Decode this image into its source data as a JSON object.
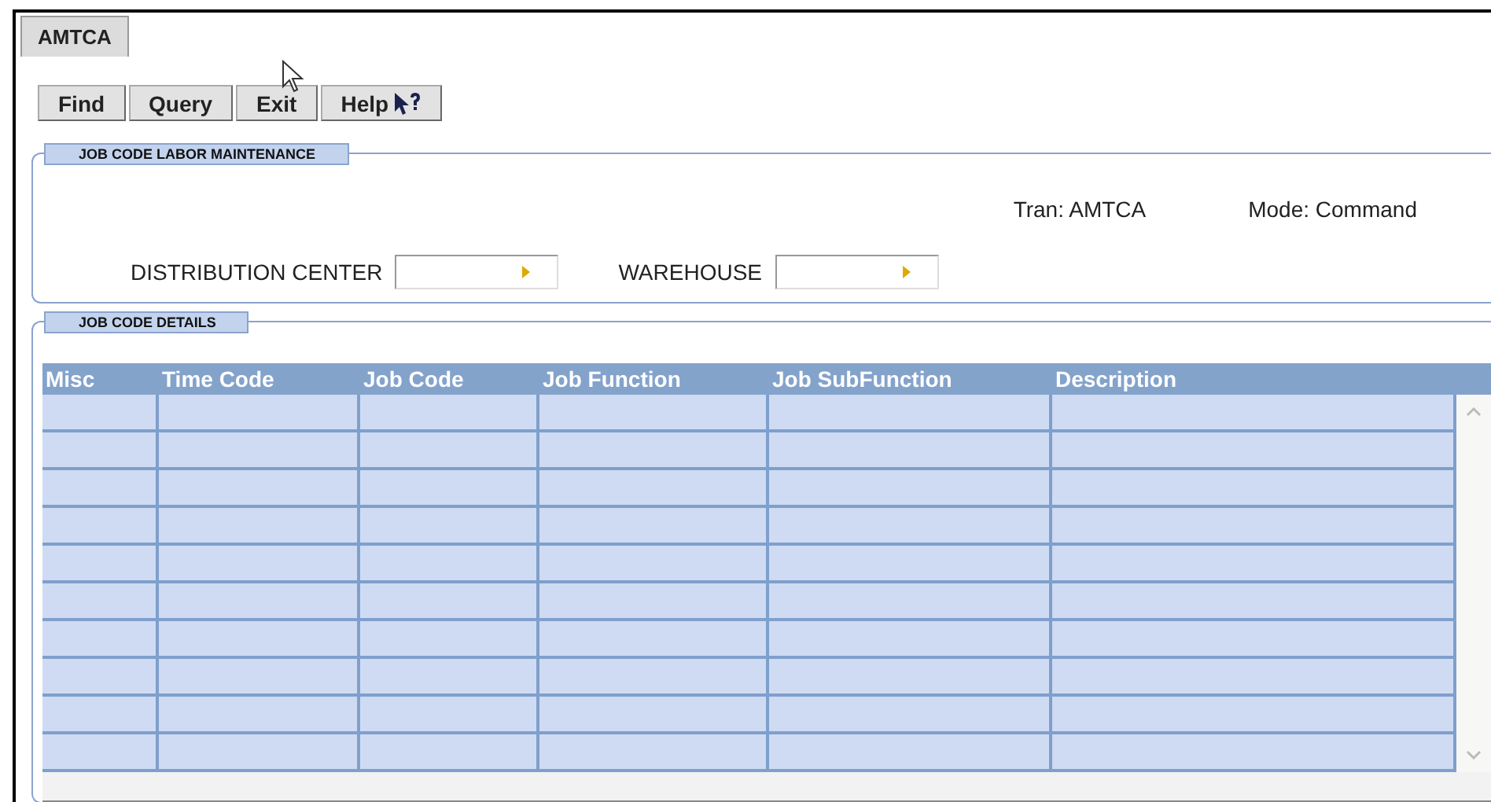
{
  "tabs": [
    {
      "label": "AMTCA",
      "selected": true
    }
  ],
  "toolbar": {
    "buttons": [
      {
        "label": "Find",
        "kind": "plain"
      },
      {
        "label": "Query",
        "kind": "plain"
      },
      {
        "label": "Exit",
        "kind": "plain"
      },
      {
        "label": "Help",
        "kind": "help"
      }
    ]
  },
  "maintenance_section": {
    "title": "JOB CODE LABOR MAINTENANCE",
    "tran": "Tran: AMTCA",
    "mode": "Mode: Command",
    "fields": [
      {
        "label": "DISTRIBUTION CENTER"
      },
      {
        "label": "WAREHOUSE"
      }
    ]
  },
  "details_section": {
    "title": "JOB CODE DETAILS",
    "table": {
      "columns": [
        "Misc",
        "Time Code",
        "Job Code",
        "Job Function",
        "Job SubFunction",
        "Description"
      ]
    }
  }
}
